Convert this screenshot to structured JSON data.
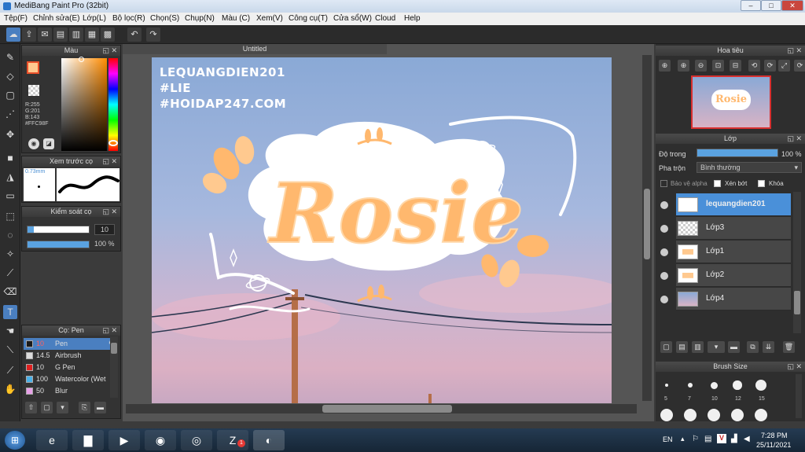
{
  "window": {
    "title": "MediBang Paint Pro (32bit)",
    "min": "–",
    "max": "□",
    "close": "✕"
  },
  "menu": [
    "Tệp(F)",
    "Chỉnh sửa(E)",
    "Lớp(L)",
    "Bộ lọc(R)",
    "Chọn(S)",
    "Chụp(N)",
    "Màu (C)",
    "Xem(V)",
    "Công cụ(T)",
    "Cửa sổ(W)",
    "Cloud",
    "Help"
  ],
  "color_panel": {
    "title": "Màu",
    "r": "R:255",
    "g": "G:201",
    "b": "B:143",
    "hex": "#FFC98F",
    "accent": "#ffc98f"
  },
  "brush_preview": {
    "title": "Xem trước cọ",
    "size": "0.73mm"
  },
  "brush_control": {
    "title": "Kiểm soát cọ",
    "size_value": "10",
    "opacity_value": "100 %",
    "size_fraction": 0.1,
    "opacity_fraction": 1.0
  },
  "brush_list": {
    "title": "Cọ: Pen",
    "items": [
      {
        "size": "10",
        "name": "Pen",
        "color": "#1a1a1a",
        "selected": true
      },
      {
        "size": "14.5",
        "name": "Airbrush",
        "color": "#dcdcdc"
      },
      {
        "size": "10",
        "name": "G Pen",
        "color": "#e02020"
      },
      {
        "size": "100",
        "name": "Watercolor (Wet",
        "color": "#4ab0e8"
      },
      {
        "size": "50",
        "name": "Blur",
        "color": "#e8a0e8"
      }
    ]
  },
  "document": {
    "tab": "Untitled"
  },
  "artwork": {
    "watermark": [
      "LEQUANGDIEN201",
      "#LIE",
      "#HOIDAP247.COM"
    ],
    "lettering": "Rosie"
  },
  "navigator": {
    "title": "Hoa tiêu"
  },
  "layer_panel": {
    "title": "Lớp",
    "opacity_label": "Độ trong",
    "opacity_value": "100 %",
    "opacity_fraction": 1.0,
    "blend_label": "Pha trộn",
    "blend_value": "Bình thường",
    "protect_alpha": "Bảo vệ alpha",
    "clipping": "Xén bớt",
    "lock": "Khóa",
    "layers": [
      "lequangdien201",
      "Lớp3",
      "Lớp1",
      "Lớp2",
      "Lớp4"
    ]
  },
  "brush_size": {
    "title": "Brush Size",
    "sizes": [
      "5",
      "7",
      "10",
      "12",
      "15"
    ]
  },
  "taskbar": {
    "lang": "EN",
    "time": "7:28 PM",
    "date": "25/11/2021",
    "zalo_badge": "1"
  }
}
